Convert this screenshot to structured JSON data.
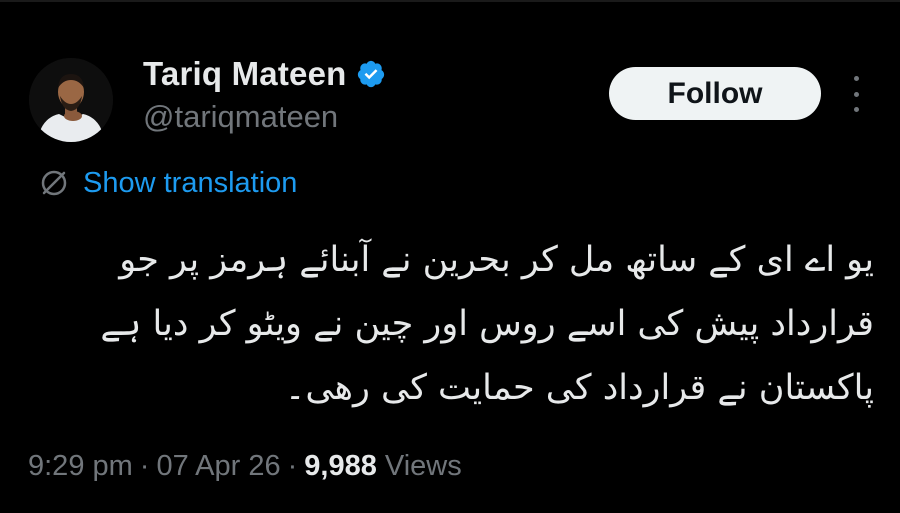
{
  "author": {
    "display_name": "Tariq Mateen",
    "handle": "@tariqmateen",
    "verified_icon": "verified-badge-icon",
    "verified_color": "#1d9bf0"
  },
  "actions": {
    "follow_label": "Follow",
    "more_icon": "more-vertical-icon"
  },
  "translation": {
    "icon": "translate-icon",
    "label": "Show translation",
    "color": "#1d9bf0"
  },
  "tweet": {
    "text": "یو اے ای کے ساتھ مل کر بحرین نے آبنائے ہرمز پر جو قرارداد پیش کی اسے روس اور چین نے ویٹو کر دیا ہے پاکستان نے قرارداد کی حمایت کی رھی۔"
  },
  "meta": {
    "time": "9:29 pm",
    "separator": "·",
    "date": "07 Apr 26",
    "views_count": "9,988",
    "views_label": "Views"
  },
  "colors": {
    "background": "#000000",
    "primary_text": "#e7e9ea",
    "secondary_text": "#71767b",
    "follow_bg": "#eff3f4"
  }
}
